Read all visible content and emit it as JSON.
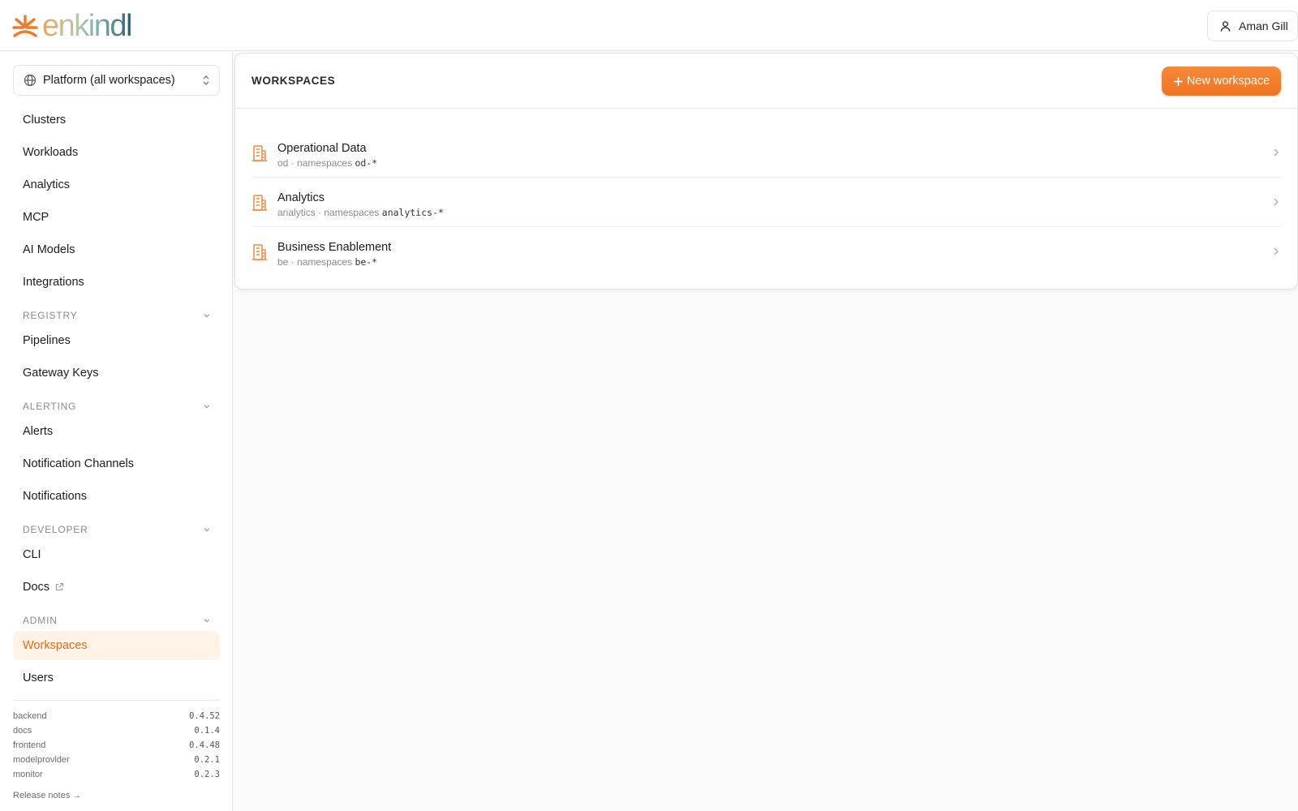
{
  "header": {
    "logo_text": "enkindl",
    "user_name": "Aman Gill"
  },
  "sidebar": {
    "workspace_selector": "Platform (all workspaces)",
    "items": [
      "Clusters",
      "Workloads",
      "Analytics",
      "MCP",
      "AI Models",
      "Integrations"
    ],
    "sections": [
      {
        "title": "REGISTRY",
        "items": [
          "Pipelines",
          "Gateway Keys"
        ]
      },
      {
        "title": "ALERTING",
        "items": [
          "Alerts",
          "Notification Channels",
          "Notifications"
        ]
      },
      {
        "title": "DEVELOPER",
        "items": [
          "CLI",
          "Docs"
        ]
      },
      {
        "title": "ADMIN",
        "items": [
          "Workspaces",
          "Users"
        ]
      }
    ],
    "active_item": "Workspaces",
    "versions": [
      {
        "name": "backend",
        "version": "0.4.52"
      },
      {
        "name": "docs",
        "version": "0.1.4"
      },
      {
        "name": "frontend",
        "version": "0.4.48"
      },
      {
        "name": "modelprovider",
        "version": "0.2.1"
      },
      {
        "name": "monitor",
        "version": "0.2.3"
      }
    ],
    "release_notes": "Release notes →"
  },
  "main": {
    "title": "WORKSPACES",
    "new_button": "New workspace",
    "sep": "·",
    "namespaces_label": "namespaces",
    "workspaces": [
      {
        "name": "Operational Data",
        "slug": "od",
        "pattern": "od-*"
      },
      {
        "name": "Analytics",
        "slug": "analytics",
        "pattern": "analytics-*"
      },
      {
        "name": "Business Enablement",
        "slug": "be",
        "pattern": "be-*"
      }
    ]
  },
  "colors": {
    "accent": "#ee7420",
    "active_bg": "#fff3e8",
    "active_text": "#e06d14",
    "icon": "#f08a3c"
  }
}
